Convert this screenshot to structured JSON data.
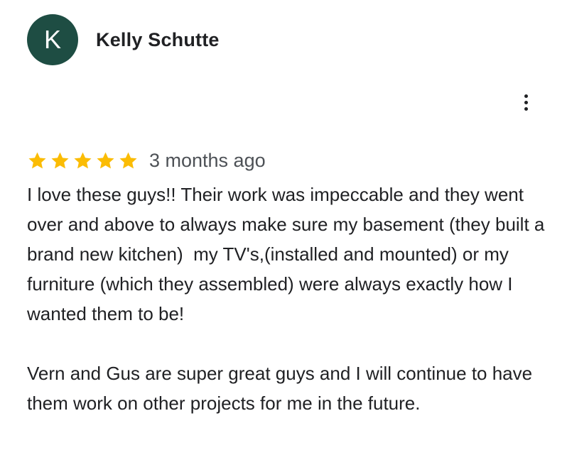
{
  "reviewer": {
    "initial": "K",
    "name": "Kelly Schutte",
    "avatar_color": "#1e4d43"
  },
  "menu": {
    "icon": "more-vert-icon"
  },
  "review": {
    "rating": 5,
    "max_rating": 5,
    "star_color": "#fbbc04",
    "date": "3 months ago",
    "paragraphs": [
      "I love these guys!! Their work was impeccable and they went over and above to always make sure my basement (they built a brand new kitchen)  my TV's,(installed and mounted) or my furniture (which they assembled) were always exactly how I wanted them to be!",
      "Vern and Gus are super great guys and I will continue to have them work on other projects for me in the future."
    ]
  }
}
